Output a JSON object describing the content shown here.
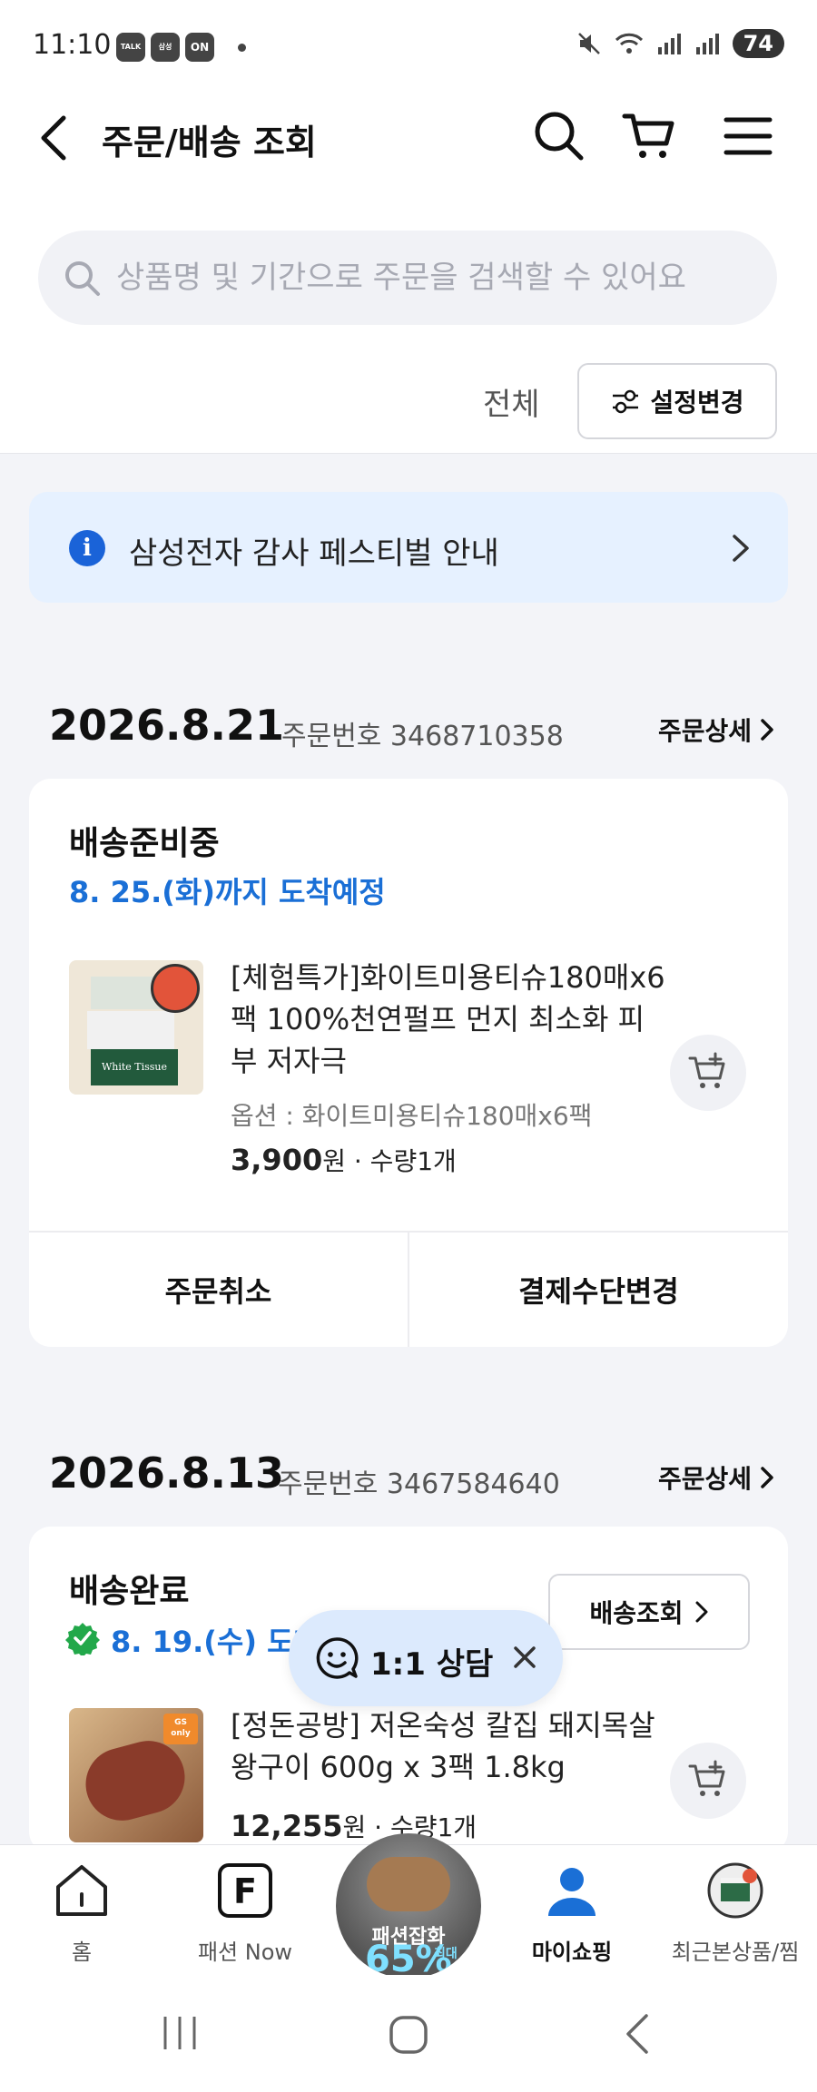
{
  "status_bar": {
    "time": "11:10",
    "badges": [
      "TALK",
      "삼성",
      "ON"
    ],
    "battery": "74"
  },
  "header": {
    "title": "주문/배송 조회"
  },
  "search": {
    "placeholder": "상품명 및 기간으로 주문을 검색할 수 있어요"
  },
  "filter": {
    "all_label": "전체",
    "settings_label": "설정변경"
  },
  "banner": {
    "text": "삼성전자 감사 페스티벌 안내"
  },
  "orders": [
    {
      "date": "2026.8.21",
      "order_no": "주문번호 3468710358",
      "detail_label": "주문상세",
      "status": "배송준비중",
      "eta": "8. 25.(화)까지 도착예정",
      "product_name": "[체험특가]화이트미용티슈180매x6팩 100%천연펄프 먼지 최소화 피부 저자극",
      "option": "옵션 : 화이트미용티슈180매x6팩",
      "price": "3,900",
      "price_suffix": "원 · 수량1개",
      "action_left": "주문취소",
      "action_right": "결제수단변경",
      "thumb_text": "White Tissue"
    },
    {
      "date": "2026.8.13",
      "order_no": "주문번호 3467584640",
      "detail_label": "주문상세",
      "status": "배송완료",
      "eta": "8. 19.(수) 도착",
      "track_label": "배송조회",
      "product_name": "[정돈공방] 저온숙성 칼집 돼지목살 왕구이 600g x 3팩 1.8kg",
      "price": "12,255",
      "price_suffix": "원 · 수량1개",
      "thumb_badge": "GS only"
    }
  ],
  "chat": {
    "label": "1:1 상담"
  },
  "bottom_nav": {
    "items": [
      {
        "label": "홈",
        "icon": "home-icon"
      },
      {
        "label": "패션 Now",
        "icon": "fashion-f-icon"
      },
      {
        "label": "마이쇼핑",
        "icon": "person-icon"
      },
      {
        "label": "최근본상품/찜",
        "icon": "recent-product-icon"
      }
    ],
    "promo_line1": "패션잡화",
    "promo_line2": "65%",
    "promo_line3": "최대"
  },
  "colors": {
    "accent_blue": "#1a6fd6",
    "banner_bg": "#e6f1ff",
    "delivered_green": "#22a84a"
  }
}
